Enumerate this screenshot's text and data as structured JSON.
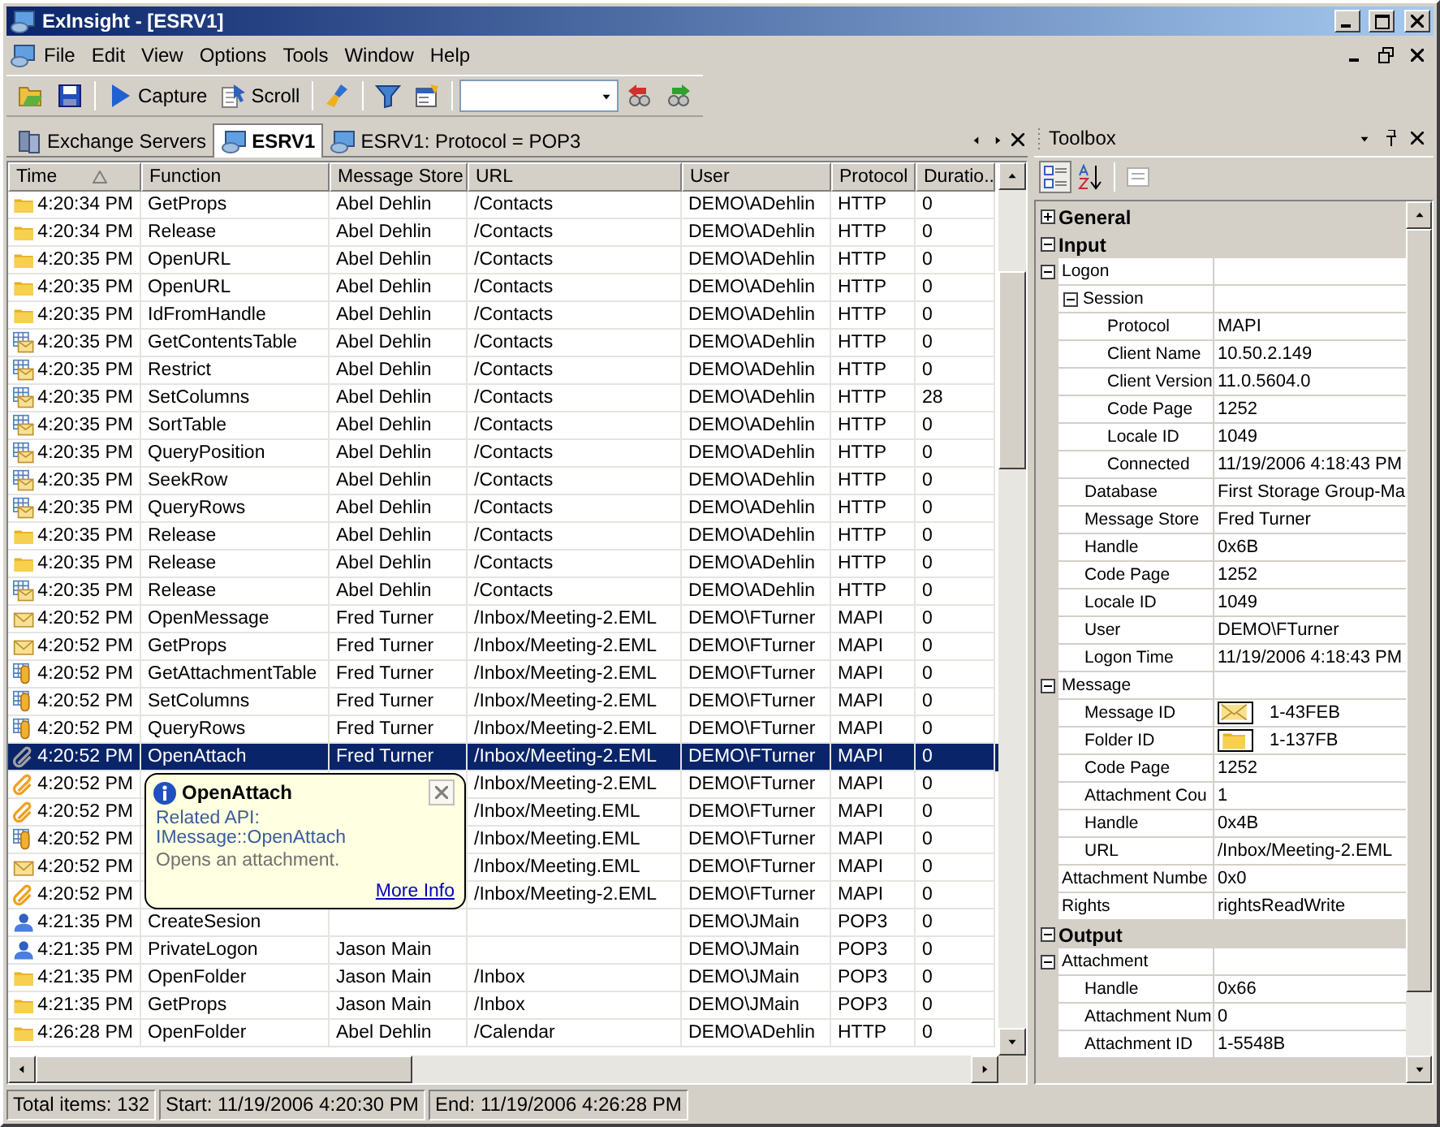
{
  "window": {
    "title": "ExInsight - [ESRV1]"
  },
  "menu": [
    {
      "label": "File"
    },
    {
      "label": "Edit"
    },
    {
      "label": "View"
    },
    {
      "label": "Options"
    },
    {
      "label": "Tools"
    },
    {
      "label": "Window"
    },
    {
      "label": "Help"
    }
  ],
  "toolbar": [
    {
      "kind": "open"
    },
    {
      "kind": "save"
    },
    {
      "kind": "separator"
    },
    {
      "kind": "capture",
      "label": "Capture"
    },
    {
      "kind": "scroll",
      "label": "Scroll"
    },
    {
      "kind": "separator"
    },
    {
      "kind": "clear"
    },
    {
      "kind": "separator"
    },
    {
      "kind": "filter"
    },
    {
      "kind": "properties"
    },
    {
      "kind": "separator"
    },
    {
      "kind": "combo"
    },
    {
      "kind": "back"
    },
    {
      "kind": "forward"
    }
  ],
  "tabs": [
    {
      "label": "Exchange Servers",
      "kind": "servers",
      "selected": false
    },
    {
      "label": "ESRV1",
      "kind": "server",
      "selected": true
    },
    {
      "label": "ESRV1: Protocol = POP3",
      "kind": "server",
      "selected": false
    }
  ],
  "table": {
    "columns": [
      {
        "label": "Time",
        "sorted": true
      },
      {
        "label": "Function"
      },
      {
        "label": "Message Store"
      },
      {
        "label": "URL"
      },
      {
        "label": "User"
      },
      {
        "label": "Protocol"
      },
      {
        "label": "Duratio.."
      }
    ],
    "rows": [
      {
        "kind": "folder",
        "selected": false,
        "time": "4:20:34 PM",
        "function": "GetProps",
        "store": "Abel Dehlin",
        "url": "/Contacts",
        "user": "DEMO\\ADehlin",
        "protocol": "HTTP",
        "duration": "0"
      },
      {
        "kind": "folder",
        "selected": false,
        "time": "4:20:34 PM",
        "function": "Release",
        "store": "Abel Dehlin",
        "url": "/Contacts",
        "user": "DEMO\\ADehlin",
        "protocol": "HTTP",
        "duration": "0"
      },
      {
        "kind": "folder",
        "selected": false,
        "time": "4:20:35 PM",
        "function": "OpenURL",
        "store": "Abel Dehlin",
        "url": "/Contacts",
        "user": "DEMO\\ADehlin",
        "protocol": "HTTP",
        "duration": "0"
      },
      {
        "kind": "folder",
        "selected": false,
        "time": "4:20:35 PM",
        "function": "OpenURL",
        "store": "Abel Dehlin",
        "url": "/Contacts",
        "user": "DEMO\\ADehlin",
        "protocol": "HTTP",
        "duration": "0"
      },
      {
        "kind": "folder",
        "selected": false,
        "time": "4:20:35 PM",
        "function": "IdFromHandle",
        "store": "Abel Dehlin",
        "url": "/Contacts",
        "user": "DEMO\\ADehlin",
        "protocol": "HTTP",
        "duration": "0"
      },
      {
        "kind": "table",
        "selected": false,
        "time": "4:20:35 PM",
        "function": "GetContentsTable",
        "store": "Abel Dehlin",
        "url": "/Contacts",
        "user": "DEMO\\ADehlin",
        "protocol": "HTTP",
        "duration": "0"
      },
      {
        "kind": "table",
        "selected": false,
        "time": "4:20:35 PM",
        "function": "Restrict",
        "store": "Abel Dehlin",
        "url": "/Contacts",
        "user": "DEMO\\ADehlin",
        "protocol": "HTTP",
        "duration": "0"
      },
      {
        "kind": "table",
        "selected": false,
        "time": "4:20:35 PM",
        "function": "SetColumns",
        "store": "Abel Dehlin",
        "url": "/Contacts",
        "user": "DEMO\\ADehlin",
        "protocol": "HTTP",
        "duration": "28"
      },
      {
        "kind": "table",
        "selected": false,
        "time": "4:20:35 PM",
        "function": "SortTable",
        "store": "Abel Dehlin",
        "url": "/Contacts",
        "user": "DEMO\\ADehlin",
        "protocol": "HTTP",
        "duration": "0"
      },
      {
        "kind": "table",
        "selected": false,
        "time": "4:20:35 PM",
        "function": "QueryPosition",
        "store": "Abel Dehlin",
        "url": "/Contacts",
        "user": "DEMO\\ADehlin",
        "protocol": "HTTP",
        "duration": "0"
      },
      {
        "kind": "table",
        "selected": false,
        "time": "4:20:35 PM",
        "function": "SeekRow",
        "store": "Abel Dehlin",
        "url": "/Contacts",
        "user": "DEMO\\ADehlin",
        "protocol": "HTTP",
        "duration": "0"
      },
      {
        "kind": "table",
        "selected": false,
        "time": "4:20:35 PM",
        "function": "QueryRows",
        "store": "Abel Dehlin",
        "url": "/Contacts",
        "user": "DEMO\\ADehlin",
        "protocol": "HTTP",
        "duration": "0"
      },
      {
        "kind": "folder",
        "selected": false,
        "time": "4:20:35 PM",
        "function": "Release",
        "store": "Abel Dehlin",
        "url": "/Contacts",
        "user": "DEMO\\ADehlin",
        "protocol": "HTTP",
        "duration": "0"
      },
      {
        "kind": "folder",
        "selected": false,
        "time": "4:20:35 PM",
        "function": "Release",
        "store": "Abel Dehlin",
        "url": "/Contacts",
        "user": "DEMO\\ADehlin",
        "protocol": "HTTP",
        "duration": "0"
      },
      {
        "kind": "table",
        "selected": false,
        "time": "4:20:35 PM",
        "function": "Release",
        "store": "Abel Dehlin",
        "url": "/Contacts",
        "user": "DEMO\\ADehlin",
        "protocol": "HTTP",
        "duration": "0"
      },
      {
        "kind": "mail",
        "selected": false,
        "time": "4:20:52 PM",
        "function": "OpenMessage",
        "store": "Fred Turner",
        "url": "/Inbox/Meeting-2.EML",
        "user": "DEMO\\FTurner",
        "protocol": "MAPI",
        "duration": "0"
      },
      {
        "kind": "mail",
        "selected": false,
        "time": "4:20:52 PM",
        "function": "GetProps",
        "store": "Fred Turner",
        "url": "/Inbox/Meeting-2.EML",
        "user": "DEMO\\FTurner",
        "protocol": "MAPI",
        "duration": "0"
      },
      {
        "kind": "attachtable",
        "selected": false,
        "time": "4:20:52 PM",
        "function": "GetAttachmentTable",
        "store": "Fred Turner",
        "url": "/Inbox/Meeting-2.EML",
        "user": "DEMO\\FTurner",
        "protocol": "MAPI",
        "duration": "0"
      },
      {
        "kind": "attachtable",
        "selected": false,
        "time": "4:20:52 PM",
        "function": "SetColumns",
        "store": "Fred Turner",
        "url": "/Inbox/Meeting-2.EML",
        "user": "DEMO\\FTurner",
        "protocol": "MAPI",
        "duration": "0"
      },
      {
        "kind": "attachtable",
        "selected": false,
        "time": "4:20:52 PM",
        "function": "QueryRows",
        "store": "Fred Turner",
        "url": "/Inbox/Meeting-2.EML",
        "user": "DEMO\\FTurner",
        "protocol": "MAPI",
        "duration": "0"
      },
      {
        "kind": "clip",
        "selected": true,
        "time": "4:20:52 PM",
        "function": "OpenAttach",
        "store": "Fred Turner",
        "url": "/Inbox/Meeting-2.EML",
        "user": "DEMO\\FTurner",
        "protocol": "MAPI",
        "duration": "0"
      },
      {
        "kind": "clip",
        "selected": false,
        "time": "4:20:52 PM",
        "url": "/Inbox/Meeting-2.EML",
        "user": "DEMO\\FTurner",
        "protocol": "MAPI",
        "duration": "0"
      },
      {
        "kind": "clip",
        "selected": false,
        "time": "4:20:52 PM",
        "url": "/Inbox/Meeting.EML",
        "user": "DEMO\\FTurner",
        "protocol": "MAPI",
        "duration": "0"
      },
      {
        "kind": "attachtable",
        "selected": false,
        "time": "4:20:52 PM",
        "url": "/Inbox/Meeting.EML",
        "user": "DEMO\\FTurner",
        "protocol": "MAPI",
        "duration": "0"
      },
      {
        "kind": "mail",
        "selected": false,
        "time": "4:20:52 PM",
        "url": "/Inbox/Meeting.EML",
        "user": "DEMO\\FTurner",
        "protocol": "MAPI",
        "duration": "0"
      },
      {
        "kind": "clip",
        "selected": false,
        "time": "4:20:52 PM",
        "url": "/Inbox/Meeting-2.EML",
        "user": "DEMO\\FTurner",
        "protocol": "MAPI",
        "duration": "0"
      },
      {
        "kind": "user",
        "selected": false,
        "time": "4:21:35 PM",
        "function": "CreateSesion",
        "user": "DEMO\\JMain",
        "protocol": "POP3",
        "duration": "0"
      },
      {
        "kind": "user",
        "selected": false,
        "time": "4:21:35 PM",
        "function": "PrivateLogon",
        "store": "Jason Main",
        "user": "DEMO\\JMain",
        "protocol": "POP3",
        "duration": "0"
      },
      {
        "kind": "folder",
        "selected": false,
        "time": "4:21:35 PM",
        "function": "OpenFolder",
        "store": "Jason Main",
        "url": "/Inbox",
        "user": "DEMO\\JMain",
        "protocol": "POP3",
        "duration": "0"
      },
      {
        "kind": "folder",
        "selected": false,
        "time": "4:21:35 PM",
        "function": "GetProps",
        "store": "Jason Main",
        "url": "/Inbox",
        "user": "DEMO\\JMain",
        "protocol": "POP3",
        "duration": "0"
      },
      {
        "kind": "folder",
        "selected": false,
        "time": "4:26:28 PM",
        "function": "OpenFolder",
        "store": "Abel Dehlin",
        "url": "/Calendar",
        "user": "DEMO\\ADehlin",
        "protocol": "HTTP",
        "duration": "0"
      }
    ]
  },
  "tooltip": {
    "title": "OpenAttach",
    "api": "Related API: IMessage::OpenAttach",
    "text": "Opens an attachment.",
    "link": "More Info"
  },
  "toolbox": {
    "title": "Toolbox",
    "buttons": [
      {
        "kind": "categorized",
        "selected": true,
        "disabled": false
      },
      {
        "kind": "alphabetical",
        "selected": false,
        "disabled": false
      },
      {
        "kind": "pages",
        "selected": false,
        "disabled": true
      }
    ],
    "properties": [
      {
        "kind": "category",
        "name": "General",
        "expanded": false
      },
      {
        "kind": "category",
        "name": "Input",
        "expanded": true,
        "children": [
          {
            "kind": "group",
            "name": "Logon",
            "expanded": true,
            "children": [
              {
                "kind": "group",
                "name": "Session",
                "expanded": true,
                "children": [
                  {
                    "kind": "property",
                    "name": "Protocol",
                    "value": "MAPI"
                  },
                  {
                    "kind": "property",
                    "name": "Client Name",
                    "value": "10.50.2.149"
                  },
                  {
                    "kind": "property",
                    "name": "Client Version",
                    "value": "11.0.5604.0"
                  },
                  {
                    "kind": "property",
                    "name": "Code Page",
                    "value": "1252"
                  },
                  {
                    "kind": "property",
                    "name": "Locale ID",
                    "value": "1049"
                  },
                  {
                    "kind": "property",
                    "name": "Connected",
                    "value": "11/19/2006 4:18:43 PM"
                  }
                ]
              },
              {
                "kind": "property",
                "name": "Database",
                "value": "First Storage Group-Ma"
              },
              {
                "kind": "property",
                "name": "Message Store",
                "value": "Fred Turner"
              },
              {
                "kind": "property",
                "name": "Handle",
                "value": "0x6B"
              },
              {
                "kind": "property",
                "name": "Code Page",
                "value": "1252"
              },
              {
                "kind": "property",
                "name": "Locale ID",
                "value": "1049"
              },
              {
                "kind": "property",
                "name": "User",
                "value": "DEMO\\FTurner"
              },
              {
                "kind": "property",
                "name": "Logon Time",
                "value": "11/19/2006 4:18:43 PM"
              }
            ]
          },
          {
            "kind": "group",
            "name": "Message",
            "expanded": true,
            "children": [
              {
                "kind": "message_ref",
                "name": "Message ID",
                "value": "1-43FEB"
              },
              {
                "kind": "folder_ref",
                "name": "Folder ID",
                "value": "1-137FB"
              },
              {
                "kind": "property",
                "name": "Code Page",
                "value": "1252"
              },
              {
                "kind": "property",
                "name": "Attachment Cou",
                "value": "1"
              },
              {
                "kind": "property",
                "name": "Handle",
                "value": "0x4B"
              },
              {
                "kind": "property",
                "name": "URL",
                "value": "/Inbox/Meeting-2.EML"
              }
            ]
          },
          {
            "kind": "property",
            "name": "Attachment Numbe",
            "value": "0x0"
          },
          {
            "kind": "property",
            "name": "Rights",
            "value": "rightsReadWrite"
          }
        ]
      },
      {
        "kind": "category",
        "name": "Output",
        "expanded": true,
        "children": [
          {
            "kind": "group",
            "name": "Attachment",
            "expanded": true,
            "children": [
              {
                "kind": "property",
                "name": "Handle",
                "value": "0x66"
              },
              {
                "kind": "property",
                "name": "Attachment Num",
                "value": "0"
              },
              {
                "kind": "property",
                "name": "Attachment ID",
                "value": "1-5548B"
              }
            ]
          }
        ]
      }
    ]
  },
  "status_bar": [
    "Total items: 132",
    "Start: 11/19/2006 4:20:30 PM",
    "End: 11/19/2006 4:26:28 PM"
  ]
}
